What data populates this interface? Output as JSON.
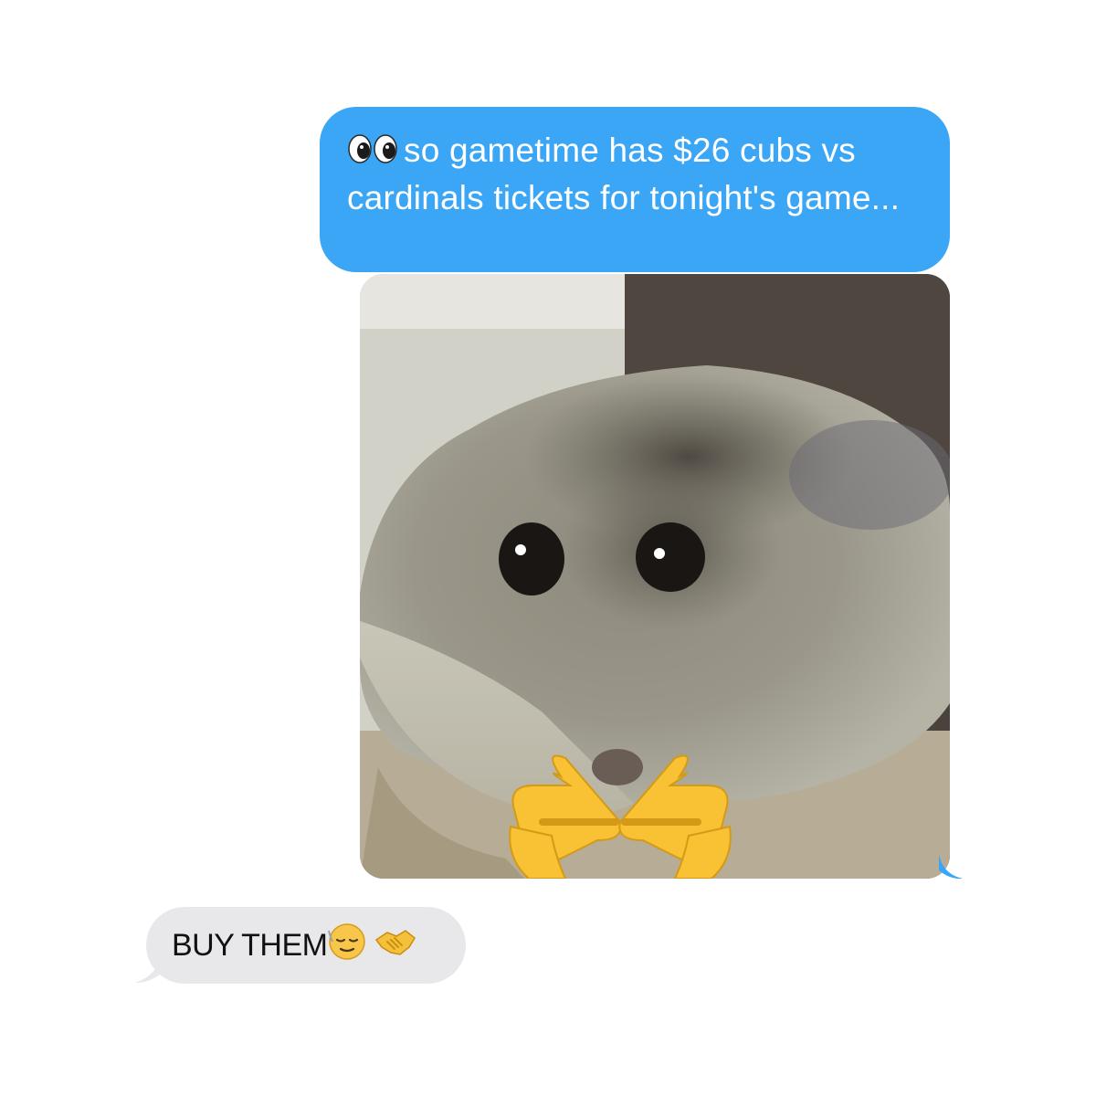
{
  "thread": {
    "outgoing_message": {
      "emoji": "eyes",
      "text": "so gametime has $26 cubs vs cardinals tickets for tonight's game..."
    },
    "photo_message": {
      "subject": "hamster",
      "overlay_emoji": [
        "pointing-right-hand",
        "pointing-left-hand"
      ]
    },
    "incoming_message": {
      "text": "BUY THEM",
      "emojis": [
        "relieved-face",
        "handshake"
      ]
    }
  },
  "colors": {
    "outgoing_bubble": "#3aa6f5",
    "incoming_bubble": "#e8e8ea",
    "background": "#ffffff"
  }
}
